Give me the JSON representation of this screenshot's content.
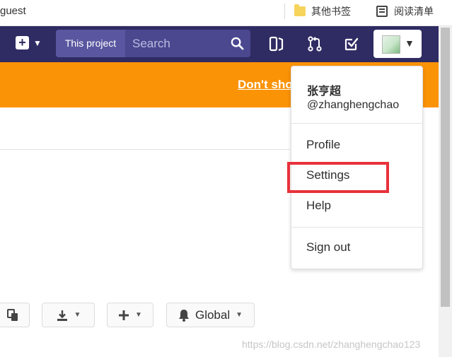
{
  "browser": {
    "user_label": "guest",
    "bookmarks": [
      {
        "label": "其他书签",
        "icon": "folder-icon"
      },
      {
        "label": "阅读清单",
        "icon": "reading-list-icon"
      }
    ]
  },
  "navbar": {
    "search_scope": "This project",
    "search_placeholder": "Search",
    "colors": {
      "navbar_bg": "#2f2b63",
      "search_bg": "#4b4890"
    }
  },
  "banner": {
    "link_text": "Don't sho",
    "color": "#fb9307"
  },
  "user_menu": {
    "name": "张亨超",
    "username": "@zhanghengchao",
    "items": [
      {
        "label": "Profile"
      },
      {
        "label": "Settings",
        "highlighted": true
      },
      {
        "label": "Help"
      }
    ],
    "sign_out": "Sign out",
    "highlight_color": "#e8313b"
  },
  "actions": {
    "notification_level": "Global"
  },
  "watermark": "https://blog.csdn.net/zhanghengchao123"
}
